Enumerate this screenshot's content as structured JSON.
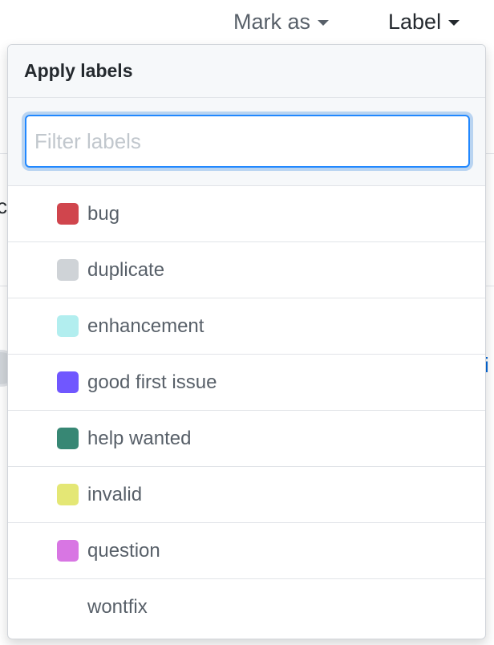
{
  "toolbar": {
    "mark_as_label": "Mark as",
    "label_label": "Label"
  },
  "background": {
    "left_fragment": "c",
    "right_fragment": "i"
  },
  "popover": {
    "title": "Apply labels",
    "filter": {
      "value": "",
      "placeholder": "Filter labels"
    },
    "labels": [
      {
        "name": "bug",
        "color": "#d0454d"
      },
      {
        "name": "duplicate",
        "color": "#cfd3d7"
      },
      {
        "name": "enhancement",
        "color": "#b2eeef"
      },
      {
        "name": "good first issue",
        "color": "#7057ff"
      },
      {
        "name": "help wanted",
        "color": "#378774"
      },
      {
        "name": "invalid",
        "color": "#e4e775"
      },
      {
        "name": "question",
        "color": "#d876e3"
      },
      {
        "name": "wontfix",
        "color": "#ffffff"
      }
    ]
  },
  "colors": {
    "accent": "#2188ff",
    "header_bg": "#f6f8fa",
    "border": "#e1e4e8"
  }
}
